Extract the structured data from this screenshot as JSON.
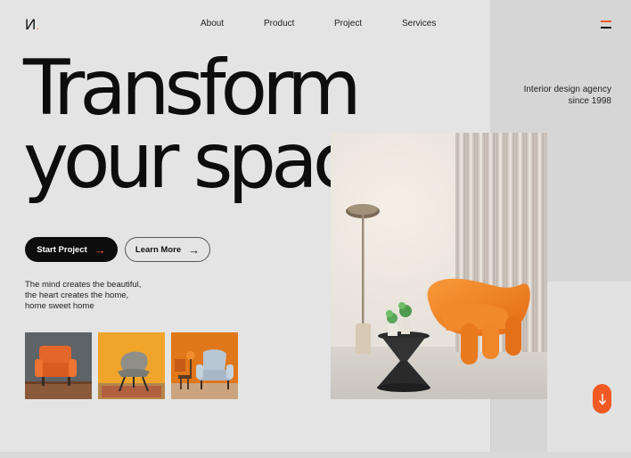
{
  "brand": {
    "logo_text": "И",
    "logo_dot": "."
  },
  "nav": {
    "items": [
      "About",
      "Product",
      "Project",
      "Services"
    ]
  },
  "hero": {
    "title_line1": "Transform",
    "title_line2": "your space",
    "agency_line1": "Interior design agency",
    "agency_line2": "since 1998",
    "tagline": "The mind creates the beautiful, the heart creates the home, home sweet home"
  },
  "actions": {
    "primary_label": "Start Project",
    "secondary_label": "Learn More"
  },
  "icons": {
    "menu": "hamburger-menu-icon",
    "arrow_right": "arrow-right-icon",
    "arrow_down": "arrow-down-icon"
  },
  "thumbnails": [
    {
      "name": "orange-armchair"
    },
    {
      "name": "grey-lounge-chair"
    },
    {
      "name": "blue-armchair"
    }
  ],
  "colors": {
    "accent": "#f15a24",
    "background": "#e4e4e4",
    "panel": "#d6d6d6",
    "text": "#0d0d0d"
  }
}
